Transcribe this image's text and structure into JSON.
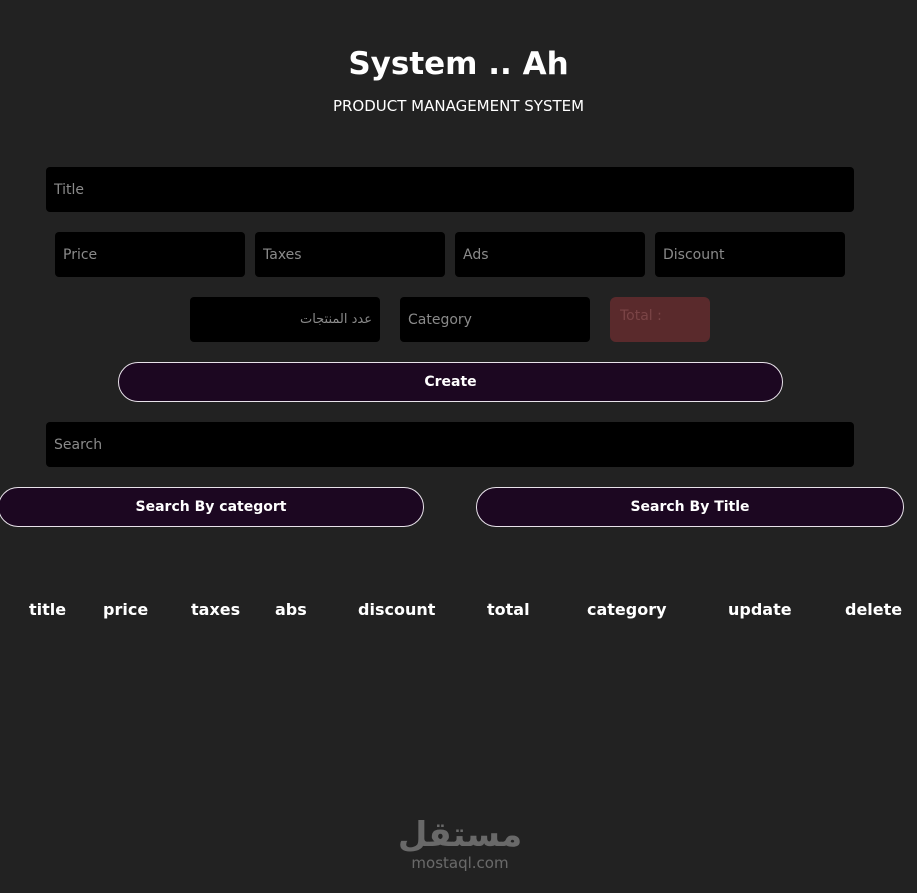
{
  "header": {
    "title": "System .. Ah",
    "subtitle": "PRODUCT MANAGEMENT SYSTEM"
  },
  "form": {
    "title_placeholder": "Title",
    "price_placeholder": "Price",
    "taxes_placeholder": "Taxes",
    "ads_placeholder": "Ads",
    "discount_placeholder": "Discount",
    "count_placeholder": "عدد المنتجات",
    "category_placeholder": "Category",
    "total_label": "Total :",
    "create_label": "Create"
  },
  "search": {
    "placeholder": "Search",
    "by_category_label": "Search By categort",
    "by_title_label": "Search By Title"
  },
  "table": {
    "headers": [
      "title",
      "price",
      "taxes",
      "abs",
      "discount",
      "total",
      "category",
      "update",
      "delete"
    ]
  },
  "watermark": {
    "arabic": "مستقل",
    "latin": "mostaql.com"
  },
  "colors": {
    "background": "#222222",
    "input_background": "#000000",
    "button_background": "#1c0721",
    "total_background": "#5a2a2c"
  }
}
